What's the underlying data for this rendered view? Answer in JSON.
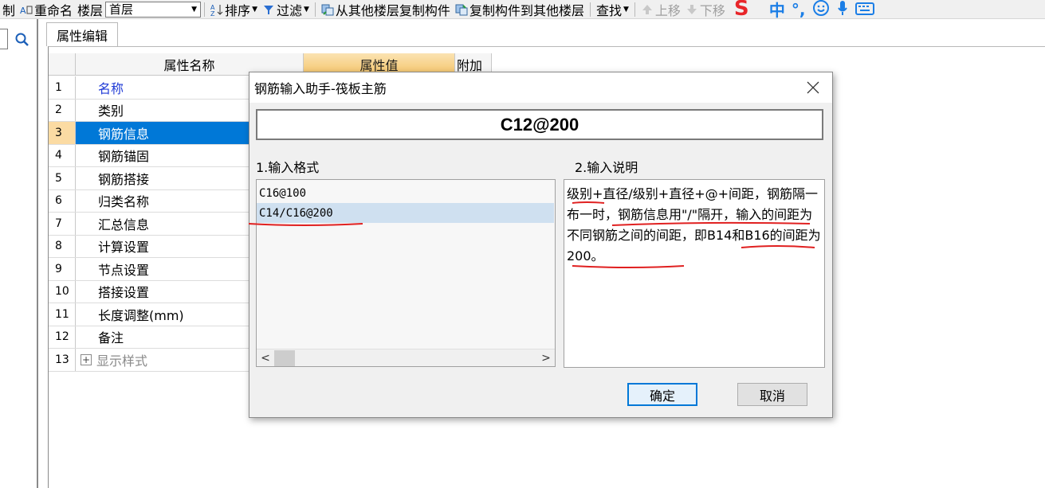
{
  "toolbar": {
    "cut_tail": "制",
    "rename": "重命名",
    "floor_label": "楼层",
    "floor_value": "首层",
    "sort": "排序",
    "filter": "过滤",
    "copy_from": "从其他楼层复制构件",
    "copy_to": "复制构件到其他楼层",
    "find": "查找",
    "move_up": "上移",
    "move_down": "下移",
    "ime_zh": "中",
    "ime_punct": "°,"
  },
  "panel": {
    "tab": "属性编辑",
    "headers": {
      "name": "属性名称",
      "value": "属性值",
      "extra": "附加"
    },
    "rows": [
      {
        "num": "1",
        "name": "名称"
      },
      {
        "num": "2",
        "name": "类别"
      },
      {
        "num": "3",
        "name": "钢筋信息"
      },
      {
        "num": "4",
        "name": "钢筋锚固"
      },
      {
        "num": "5",
        "name": "钢筋搭接"
      },
      {
        "num": "6",
        "name": "归类名称"
      },
      {
        "num": "7",
        "name": "汇总信息"
      },
      {
        "num": "8",
        "name": "计算设置"
      },
      {
        "num": "9",
        "name": "节点设置"
      },
      {
        "num": "10",
        "name": "搭接设置"
      },
      {
        "num": "11",
        "name": "长度调整(mm)"
      },
      {
        "num": "12",
        "name": "备注"
      },
      {
        "num": "13",
        "name": "显示样式",
        "expander": "+"
      }
    ]
  },
  "dialog": {
    "title": "钢筋输入助手-筏板主筋",
    "value": "C12@200",
    "format_label": "1.输入格式",
    "help_label": "2.输入说明",
    "formats": [
      "C16@100",
      "C14/C16@200"
    ],
    "help_text": "级别+直径/级别+直径+@+间距，钢筋隔一布一时，钢筋信息用\"/\"隔开，输入的间距为不同钢筋之间的间距，即B14和B16的间距为200。",
    "ok": "确定",
    "cancel": "取消"
  },
  "colors": {
    "selection": "#0078d7",
    "name_blue": "#1f3ad6",
    "annotation_red": "#e02020",
    "header_orange": "#f4c56b"
  }
}
